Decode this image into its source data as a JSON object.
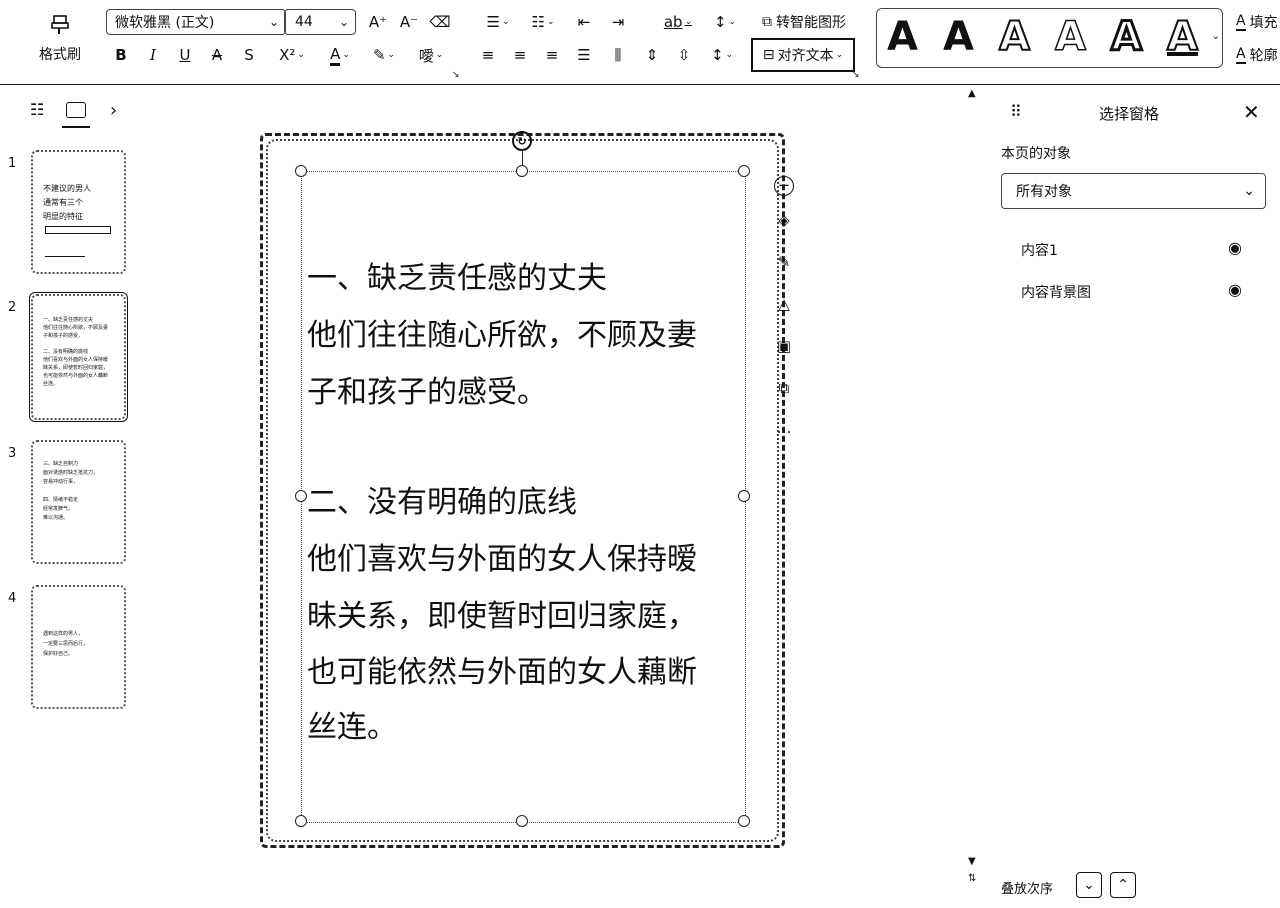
{
  "ribbon": {
    "format_painter": "格式刷",
    "font_name": "微软雅黑 (正文)",
    "font_size": "44",
    "to_smart_art": "转智能图形",
    "align_text": "对齐文本",
    "text_fill": "填充",
    "text_outline": "轮廓",
    "buttons": {
      "bold": "B",
      "italic": "I",
      "underline": "U",
      "strike": "A",
      "shadow": "S",
      "superscript": "X²",
      "font_color": "A",
      "highlight": "✎",
      "phonetic": "噯",
      "grow": "A⁺",
      "shrink": "A⁻",
      "clear": "⌫",
      "char_spacing": "ab"
    },
    "wordart_samples": [
      "A",
      "A",
      "A",
      "A",
      "A",
      "A"
    ]
  },
  "left_pane": {
    "slides": [
      {
        "num": "1",
        "lines": [
          "不建议的男人",
          "通常有三个",
          "明显的特征"
        ]
      },
      {
        "num": "2",
        "lines": [
          "一、缺乏责任感的丈夫",
          "他们往往随心所欲，不顾及妻",
          "子和孩子的感受。",
          "",
          "二、没有明确的底线",
          "他们喜欢与外面的女人保持暧",
          "昧关系，即使暂时回归家庭，",
          "也可能依然与外面的女人藕断",
          "丝连。"
        ]
      },
      {
        "num": "3",
        "lines": [
          "三、缺乏自制力",
          "面对诱惑时缺乏抵抗力，",
          "容易冲动行事，",
          "",
          "四、情绪不稳定",
          "经常发脾气，",
          "难以沟通。"
        ]
      },
      {
        "num": "4",
        "lines": [
          "遇到这样的男人，",
          "一定要三思而后行，",
          "保护好自己。"
        ]
      }
    ]
  },
  "slide": {
    "lines": [
      "一、缺乏责任感的丈夫",
      "他们往往随心所欲，不顾及妻",
      "子和孩子的感受。",
      "",
      "二、没有明确的底线",
      "他们喜欢与外面的女人保持暧",
      "昧关系，即使暂时回归家庭，",
      "也可能依然与外面的女人藕断",
      "丝连。"
    ]
  },
  "selection_pane": {
    "title": "选择窗格",
    "objects_label": "本页的对象",
    "filter_value": "所有对象",
    "items": [
      {
        "name": "内容1"
      },
      {
        "name": "内容背景图"
      }
    ],
    "order_label": "叠放次序"
  }
}
